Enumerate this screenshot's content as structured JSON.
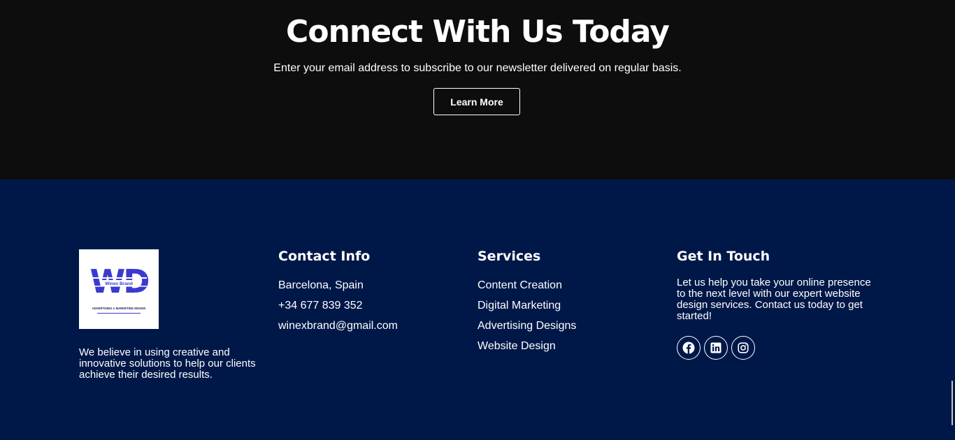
{
  "cta": {
    "title": "Connect With Us Today",
    "subtitle": "Enter your email address to subscribe to our newsletter delivered on regular basis.",
    "button_label": "Learn More"
  },
  "logo": {
    "monogram": "WD",
    "brand": "Winex Brand",
    "tagline_a": "ADVERTISING",
    "tagline_amp": "&",
    "tagline_b": "MARKETING DESIGN",
    "accent": "#3a3ad0"
  },
  "about": {
    "text": "We believe in using creative and innovative solutions to help our clients achieve their desired results."
  },
  "contact": {
    "title": "Contact Info",
    "items": [
      "Barcelona, Spain",
      "+34 677 839 352",
      "winexbrand@gmail.com"
    ]
  },
  "services": {
    "title": "Services",
    "items": [
      "Content Creation",
      "Digital Marketing",
      "Advertising Designs",
      "Website Design"
    ]
  },
  "touch": {
    "title": "Get In Touch",
    "text": "Let us help you take your online presence to the next level with our expert website design services. Contact us today to get started!",
    "social": [
      "facebook-icon",
      "linkedin-icon",
      "instagram-icon"
    ]
  },
  "colors": {
    "cta_bg": "#0d0d0d",
    "footer_bg": "#001848"
  }
}
